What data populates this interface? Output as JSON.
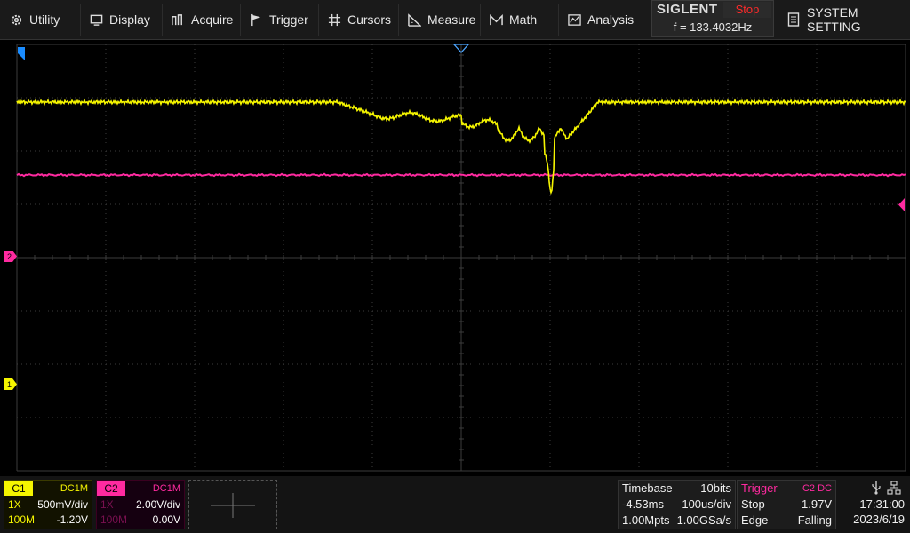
{
  "menu": {
    "items": [
      {
        "label": "Utility",
        "icon": "gear-icon"
      },
      {
        "label": "Display",
        "icon": "monitor-icon"
      },
      {
        "label": "Acquire",
        "icon": "acquire-icon"
      },
      {
        "label": "Trigger",
        "icon": "flag-icon"
      },
      {
        "label": "Cursors",
        "icon": "crosshair-icon"
      },
      {
        "label": "Measure",
        "icon": "measure-icon"
      },
      {
        "label": "Math",
        "icon": "math-icon"
      },
      {
        "label": "Analysis",
        "icon": "analysis-icon"
      }
    ],
    "system_setting": "SYSTEM SETTING"
  },
  "brand": {
    "name": "SIGLENT",
    "run_status": "Stop",
    "frequency": "f = 133.4032Hz"
  },
  "colors": {
    "ch1": "#f5f500",
    "ch2": "#ff2aa0",
    "trigger_label": "#ff2aa0",
    "trigger_marker": "#1a8cff",
    "grid": "#3c3c3c"
  },
  "markers": {
    "ch1": "1",
    "ch2": "2"
  },
  "ch1": {
    "name": "C1",
    "coupling": "DC1M",
    "probe": "1X",
    "scale": "500mV/div",
    "bandwidth": "100M",
    "offset": "-1.20V"
  },
  "ch2": {
    "name": "C2",
    "coupling": "DC1M",
    "probe": "1X",
    "scale": "2.00V/div",
    "bandwidth": "100M",
    "offset": "0.00V"
  },
  "timebase": {
    "title": "Timebase",
    "bits": "10bits",
    "delay": "-4.53ms",
    "scale": "100us/div",
    "points": "1.00Mpts",
    "sample_rate": "1.00GSa/s"
  },
  "trigger": {
    "title": "Trigger",
    "source": "C2 DC",
    "mode": "Stop",
    "level": "1.97V",
    "type": "Edge",
    "slope": "Falling"
  },
  "status": {
    "time": "17:31:00",
    "date": "2023/6/19",
    "usb_icon": "usb-icon",
    "network_icon": "network-icon"
  }
}
